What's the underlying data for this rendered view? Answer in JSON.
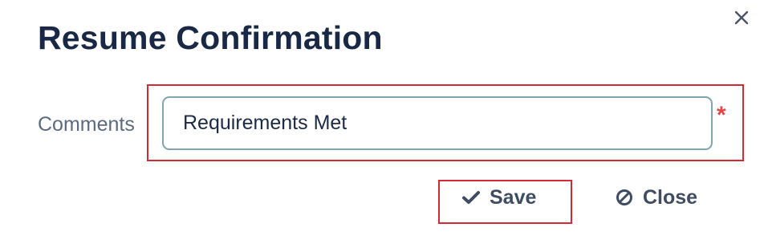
{
  "dialog": {
    "title": "Resume Confirmation",
    "close_icon": "close-x-icon"
  },
  "form": {
    "comments": {
      "label": "Comments",
      "value": "Requirements Met",
      "required_mark": "*"
    }
  },
  "actions": {
    "save_label": "Save",
    "save_icon": "checkmark-icon",
    "close_label": "Close",
    "close_icon": "ban-circle-icon"
  },
  "colors": {
    "title": "#182845",
    "label": "#5b6a80",
    "input_border": "#7fa6ae",
    "required": "#e04848",
    "highlight": "#d42a35",
    "button_text": "#3f4d63"
  }
}
